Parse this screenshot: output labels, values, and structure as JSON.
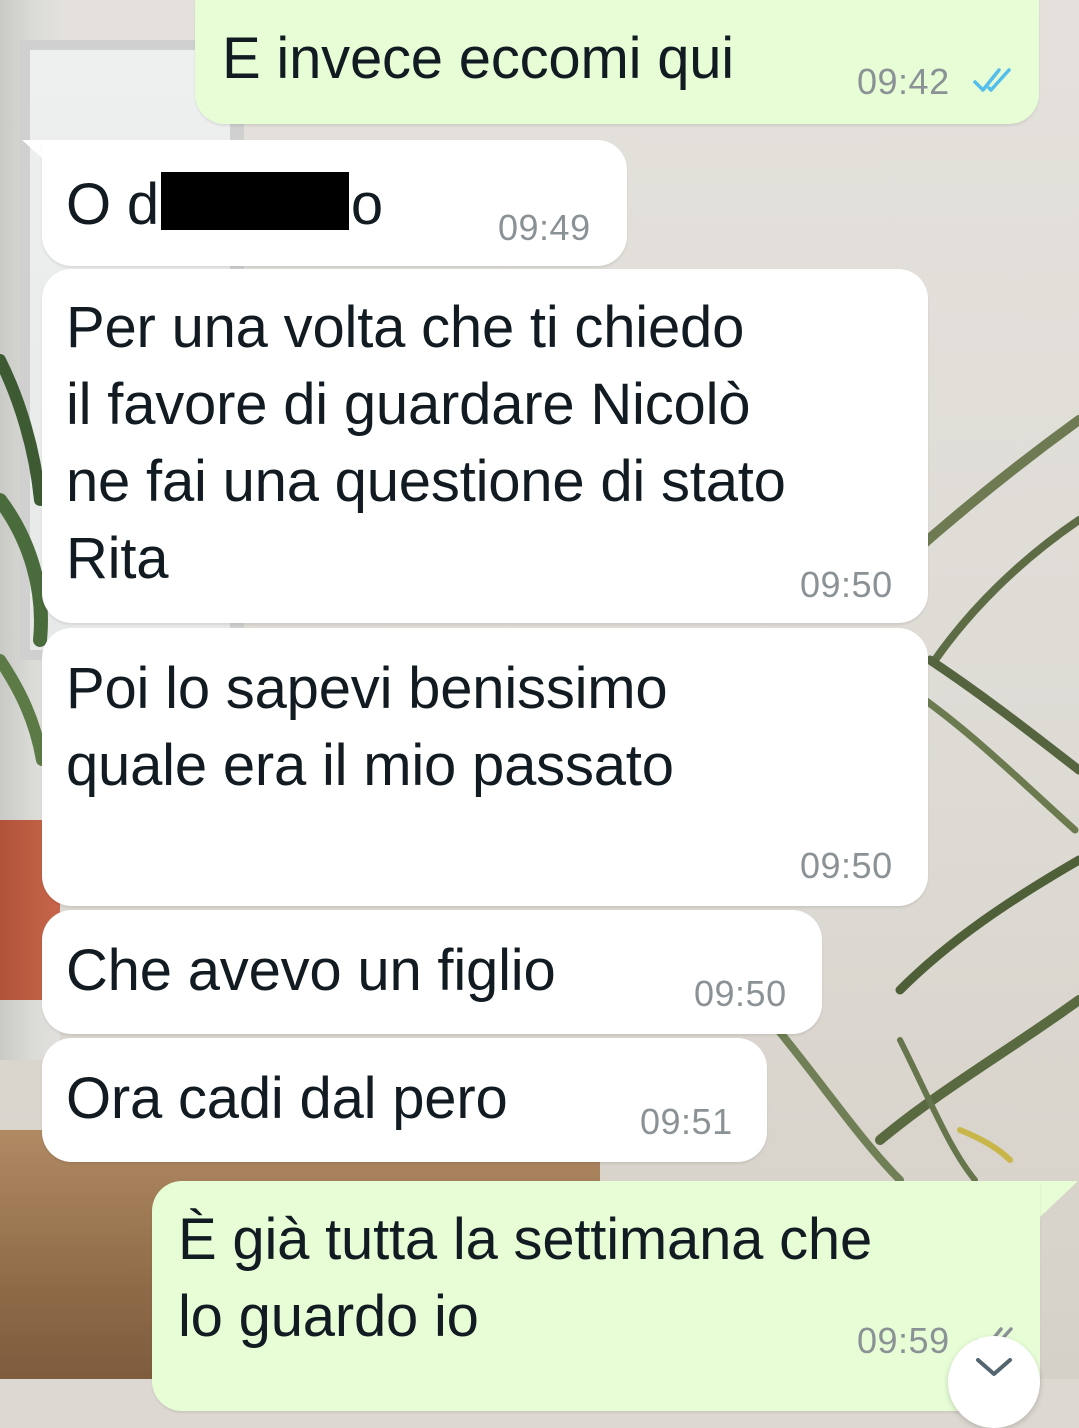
{
  "chat": {
    "messages": [
      {
        "direction": "outgoing",
        "text": "E invece eccomi qui",
        "time": "09:42",
        "status": "read"
      },
      {
        "direction": "incoming",
        "text_before": "O d",
        "text_redacted": true,
        "text_after": "o",
        "time": "09:49"
      },
      {
        "direction": "incoming",
        "text": "Per una volta che ti chiedo\nil favore di guardare Nicolò\nne fai una questione di stato\nRita",
        "time": "09:50"
      },
      {
        "direction": "incoming",
        "text": "Poi lo sapevi benissimo\nquale era il mio passato",
        "time": "09:50"
      },
      {
        "direction": "incoming",
        "text": "Che avevo un figlio",
        "time": "09:50"
      },
      {
        "direction": "incoming",
        "text": "Ora cadi dal pero",
        "time": "09:51"
      },
      {
        "direction": "outgoing",
        "text": "È già tutta la settimana che\nlo guardo io",
        "time": "09:59",
        "status": "delivered"
      }
    ]
  },
  "colors": {
    "incoming_bubble": "#ffffff",
    "outgoing_bubble": "#e7fdd6",
    "text": "#111b21",
    "timestamp": "#8b9296",
    "read_tick": "#53bdeb",
    "delivered_tick": "#8b9296"
  },
  "icons": {
    "read_receipt": "double-check-icon",
    "scroll_down": "chevron-down-icon"
  }
}
